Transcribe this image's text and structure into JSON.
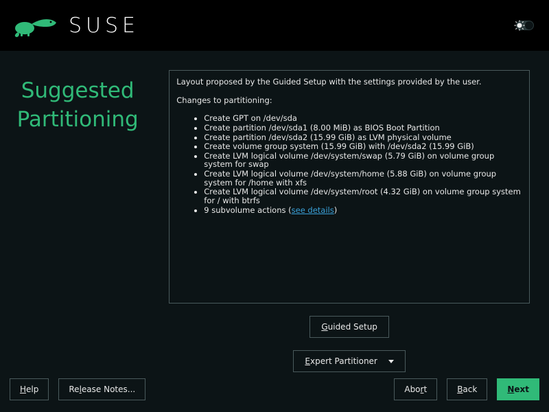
{
  "brand": "SUSE",
  "page": {
    "title": "Suggested\nPartitioning"
  },
  "panel": {
    "intro": "Layout proposed by the Guided Setup with the settings provided by the user.",
    "changes_label": "Changes to partitioning:",
    "items": [
      "Create GPT on /dev/sda",
      "Create partition /dev/sda1 (8.00 MiB) as BIOS Boot Partition",
      "Create partition /dev/sda2 (15.99 GiB) as LVM physical volume",
      "Create volume group system (15.99 GiB) with /dev/sda2 (15.99 GiB)",
      "Create LVM logical volume /dev/system/swap (5.79 GiB) on volume group system for swap",
      "Create LVM logical volume /dev/system/home (5.88 GiB) on volume group system for /home with xfs",
      "Create LVM logical volume /dev/system/root (4.32 GiB) on volume group system for / with btrfs"
    ],
    "subvol_prefix": "9 subvolume actions (",
    "subvol_link": "see details",
    "subvol_suffix": ")"
  },
  "actions": {
    "guided": "Guided Setup",
    "guided_mn": "G",
    "expert": "Expert Partitioner",
    "expert_mn": "E"
  },
  "footer": {
    "help": "Help",
    "help_mn": "H",
    "release": "Release Notes...",
    "release_mn": "l",
    "abort": "Abort",
    "abort_mn": "r",
    "back": "Back",
    "back_mn": "B",
    "next": "Next",
    "next_mn": "N"
  }
}
